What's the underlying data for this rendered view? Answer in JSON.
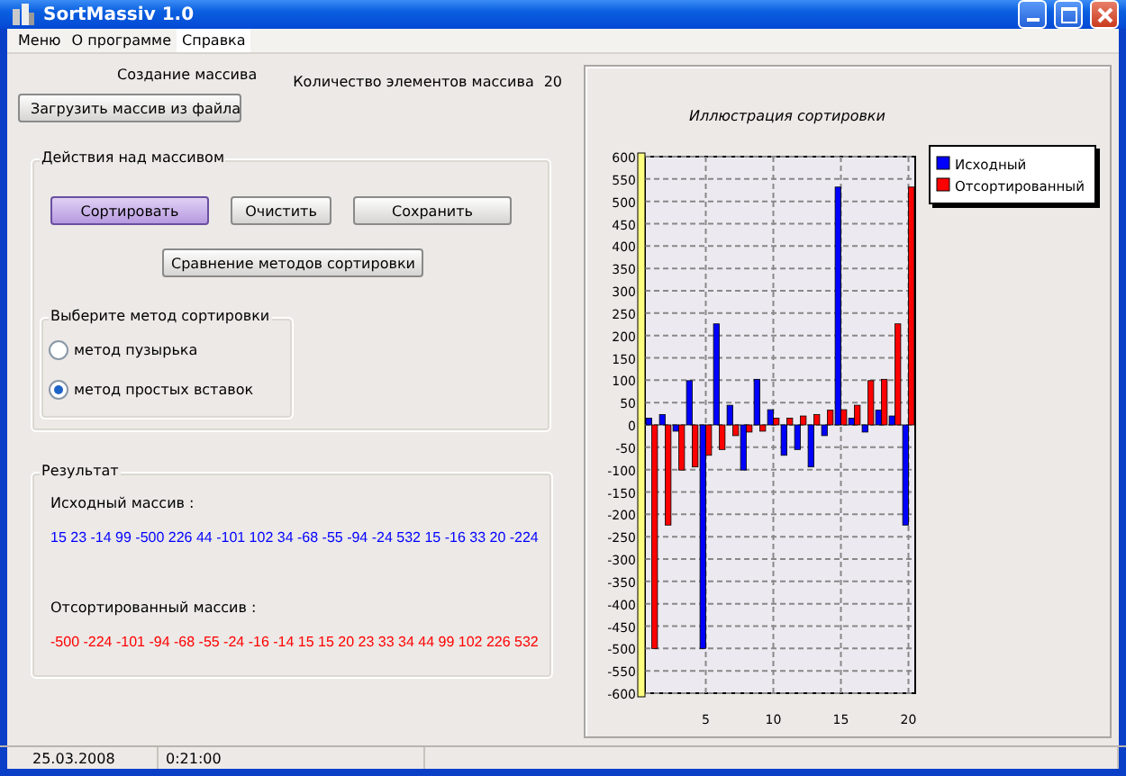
{
  "window": {
    "title": "SortMassiv 1.0"
  },
  "menu": [
    {
      "label": "Меню",
      "selected": false
    },
    {
      "label": "О программе",
      "selected": false
    },
    {
      "label": "Справка",
      "selected": true
    }
  ],
  "create": {
    "heading": "Создание массива",
    "count_label": "Количество элементов массива",
    "count": "20",
    "load_button": "Загрузить массив из файла"
  },
  "actions": {
    "title": "Действия над массивом",
    "buttons": [
      {
        "label": "Сортировать",
        "focused": true
      },
      {
        "label": "Очистить",
        "focused": false
      },
      {
        "label": "Сохранить",
        "focused": false
      }
    ],
    "compare_button": "Сравнение методов сортировки",
    "method_group": {
      "title": "Выберите метод сортировки",
      "options": [
        {
          "label": "метод пузырька",
          "selected": false
        },
        {
          "label": "метод простых вставок",
          "selected": true
        }
      ]
    }
  },
  "result": {
    "title": "Результат",
    "source_label": "Исходный массив :",
    "source": "15 23 -14 99 -500 226 44 -101 102 34 -68 -55 -94 -24 532 15 -16 33 20 -224",
    "sorted_label": "Отсортированный массив :",
    "sorted": "-500 -224 -101 -94 -68 -55 -24 -16 -14 15 15 20 23 33 34 44 99 102 226 532"
  },
  "chart": {
    "chart_data": {
      "type": "bar",
      "title": "Иллюстрация сортировки",
      "x": [
        1,
        2,
        3,
        4,
        5,
        6,
        7,
        8,
        9,
        10,
        11,
        12,
        13,
        14,
        15,
        16,
        17,
        18,
        19,
        20
      ],
      "xlim": [
        0.5,
        20.5
      ],
      "grid": true,
      "legend": true,
      "series": [
        {
          "name": "Исходный",
          "color": "#0000ff",
          "values": [
            15,
            23,
            -14,
            99,
            -500,
            226,
            44,
            -101,
            102,
            34,
            -68,
            -55,
            -94,
            -24,
            532,
            15,
            -16,
            33,
            20,
            -224
          ]
        },
        {
          "name": "Отсортированный",
          "color": "#ff0000",
          "values": [
            -500,
            -224,
            -101,
            -94,
            -68,
            -55,
            -24,
            -16,
            -14,
            15,
            15,
            20,
            23,
            33,
            34,
            44,
            99,
            102,
            226,
            532
          ]
        }
      ],
      "ylim": [
        -600,
        600
      ],
      "yticks": [
        600,
        550,
        500,
        450,
        400,
        350,
        300,
        250,
        200,
        150,
        100,
        50,
        0,
        -50,
        -100,
        -150,
        -200,
        -250,
        -300,
        -350,
        -400,
        -450,
        -500,
        -550,
        -600
      ],
      "xticks": [
        {
          "value": 5,
          "label": "5"
        },
        {
          "value": 10,
          "label": "10"
        },
        {
          "value": 15,
          "label": "15"
        },
        {
          "value": 20,
          "label": "20"
        }
      ]
    }
  },
  "status_bar": [
    "25.03.2008",
    "0:21:00"
  ]
}
